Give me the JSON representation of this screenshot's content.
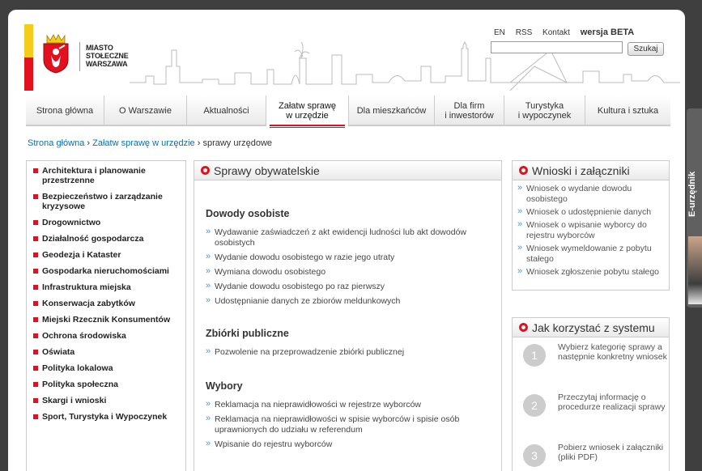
{
  "logo": {
    "lines": [
      "MIASTO",
      "STOŁECZNE",
      "WARSZAWA"
    ]
  },
  "toplinks": {
    "en": "EN",
    "rss": "RSS",
    "kontakt": "Kontakt",
    "beta": "wersja BETA"
  },
  "search": {
    "button": "Szukaj",
    "value": ""
  },
  "nav": [
    {
      "label": "Strona główna"
    },
    {
      "label": "O Warszawie"
    },
    {
      "label": "Aktualności"
    },
    {
      "label": "Załatw sprawę\nw urzędzie"
    },
    {
      "label": "Dla mieszkańców"
    },
    {
      "label": "Dla firm\ni inwestorów"
    },
    {
      "label": "Turystyka\ni wypoczynek"
    },
    {
      "label": "Kultura i sztuka"
    }
  ],
  "breadcrumb": {
    "home": "Strona główna",
    "sep1": " › ",
    "parent": "Załatw sprawę w urzędzie",
    "sep2": " › ",
    "current": "sprawy urzędowe"
  },
  "sidebar": [
    "Architektura i planowanie przestrzenne",
    "Bezpieczeństwo i zarządzanie kryzysowe",
    "Drogownictwo",
    "Działalność gospodarcza",
    "Geodezja i Kataster",
    "Gospodarka nieruchomościami",
    "Infrastruktura miejska",
    "Konserwacja zabytków",
    "Miejski Rzecznik Konsumentów",
    "Ochrona środowiska",
    "Oświata",
    "Polityka lokalowa",
    "Polityka społeczna",
    "Skargi i wnioski",
    "Sport, Turystyka i Wypoczynek"
  ],
  "main": {
    "title": "Sprawy obywatelskie",
    "sections": [
      {
        "title": "Dowody osobiste",
        "links": [
          "Wydawanie zaświadczeń z akt ewidencji ludności lub akt dowodów osobistych",
          "Wydanie dowodu osobistego w razie jego utraty",
          "Wymiana dowodu osobistego",
          "Wydanie dowodu osobistego po raz pierwszy",
          "Udostępnianie danych ze zbiorów meldunkowych"
        ]
      },
      {
        "title": "Zbiórki publiczne",
        "links": [
          "Pozwolenie na przeprowadzenie zbiórki publicznej"
        ]
      },
      {
        "title": "Wybory",
        "links": [
          "Reklamacja na nieprawidłowości w rejestrze wyborców",
          "Reklamacja na nieprawidłowości w spisie wyborców i spisie osób uprawnionych do udziału w referendum",
          "Wpisanie do rejestru wyborców"
        ]
      }
    ]
  },
  "wnioski": {
    "title": "Wnioski i załączniki",
    "links": [
      "Wniosek o wydanie dowodu osobistego",
      "Wniosek o udostępnienie danych",
      "Wniosek o wpisanie wyborcy do rejestru wyborców",
      "Wniosek wymeldowanie z pobytu stałego",
      "Wniosek zgłoszenie pobytu stałego"
    ]
  },
  "howto": {
    "title": "Jak korzystać z systemu",
    "steps": [
      {
        "num": "1",
        "text": "Wybierz kategorię sprawy a następnie konkretny wniosek"
      },
      {
        "num": "2",
        "text": "Przeczytaj informację o procedurze realizacji sprawy"
      },
      {
        "num": "3",
        "text": "Pobierz wniosek i załączniki (pliki PDF)"
      }
    ]
  },
  "etab": {
    "label": "E-urzędnik"
  },
  "colors": {
    "brand_red": "#e3101e",
    "brand_yellow": "#f5cc1b",
    "link_blue": "#0070b8"
  }
}
